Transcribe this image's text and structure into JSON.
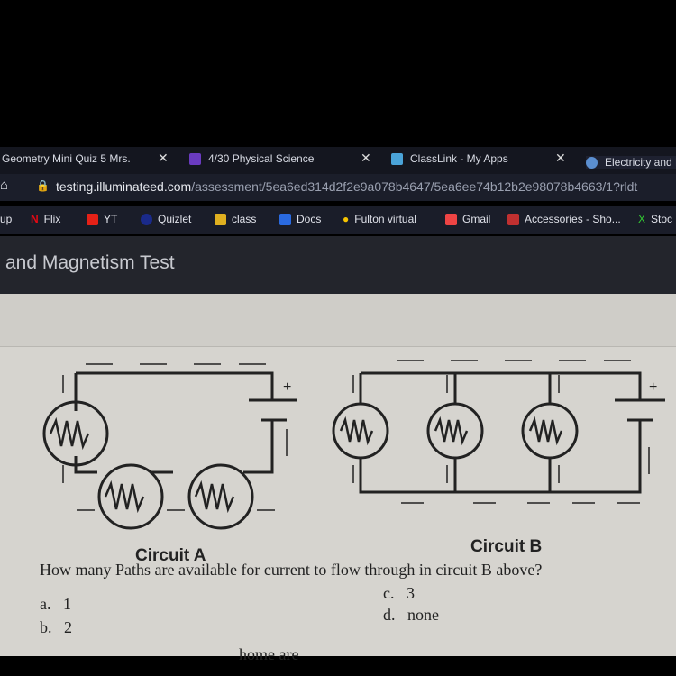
{
  "tabs": [
    {
      "title": "Geometry Mini Quiz 5 Mrs.",
      "icon": "doc-icon"
    },
    {
      "title": "4/30 Physical Science",
      "icon": "classroom-icon"
    },
    {
      "title": "ClassLink - My Apps",
      "icon": "classlink-icon"
    },
    {
      "title": "Electricity and M",
      "icon": "illuminate-icon"
    }
  ],
  "tab_close": "✕",
  "address": {
    "domain": "testing.illuminateed.com",
    "path": "/assessment/5ea6ed314d2f2e9a078b4647/5ea6ee74b12b2e98078b4663/1?rldt"
  },
  "bookmarks": [
    "up",
    "Flix",
    "YT",
    "Quizlet",
    "class",
    "Docs",
    "Fulton virtual",
    "Gmail",
    "Accessories - Sho...",
    "Stoc"
  ],
  "page_title": "and Magnetism Test",
  "circuit_a_label": "Circuit A",
  "circuit_b_label": "Circuit B",
  "question": "How many Paths are available for current to flow through in circuit B above?",
  "choices": [
    {
      "letter": "a.",
      "text": "1"
    },
    {
      "letter": "b.",
      "text": "2"
    },
    {
      "letter": "c.",
      "text": "3"
    },
    {
      "letter": "d.",
      "text": "none"
    }
  ],
  "next_question_partial": "home are",
  "colors": {
    "tab_bar": "#14161f",
    "page_bg": "#d6d4cf",
    "header": "#23252c"
  }
}
